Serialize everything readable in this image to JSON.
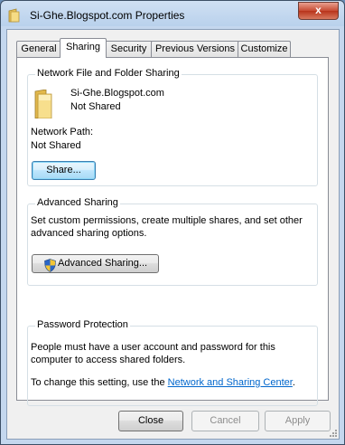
{
  "window": {
    "title": "Si-Ghe.Blogspot.com Properties",
    "close_glyph": "x"
  },
  "tabs": [
    {
      "label": "General"
    },
    {
      "label": "Sharing"
    },
    {
      "label": "Security"
    },
    {
      "label": "Previous Versions"
    },
    {
      "label": "Customize"
    }
  ],
  "network_sharing": {
    "title": "Network File and Folder Sharing",
    "folder_name": "Si-Ghe.Blogspot.com",
    "folder_status": "Not Shared",
    "path_label": "Network Path:",
    "path_value": "Not Shared",
    "share_button": "Share..."
  },
  "advanced_sharing": {
    "title": "Advanced Sharing",
    "description_line1": "Set custom permissions, create multiple shares, and set other",
    "description_line2": "advanced sharing options.",
    "button": "Advanced Sharing..."
  },
  "password_protection": {
    "title": "Password Protection",
    "line1": "People must have a user account and password for this",
    "line2": "computer to access shared folders.",
    "change_prefix": "To change this setting, use the ",
    "link": "Network and Sharing Center",
    "change_suffix": "."
  },
  "buttons": {
    "close": "Close",
    "cancel": "Cancel",
    "apply": "Apply"
  }
}
